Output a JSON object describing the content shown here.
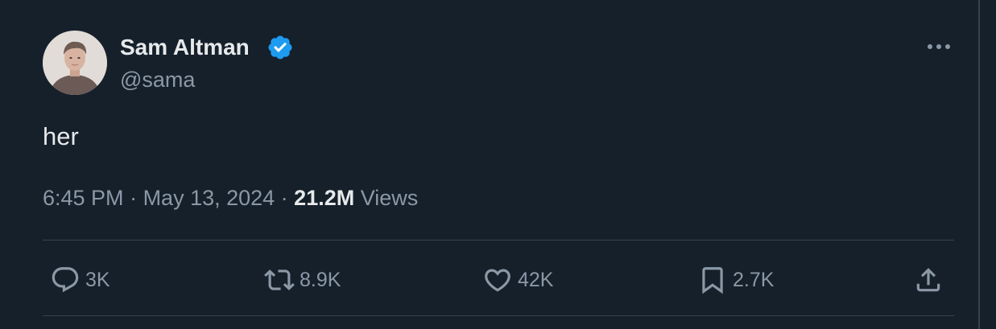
{
  "tweet": {
    "author": {
      "name": "Sam Altman",
      "handle": "@sama",
      "verified": true,
      "avatar_icon": "avatar-photo"
    },
    "text": "her",
    "meta": {
      "time": "6:45 PM",
      "separator": " · ",
      "date": "May 13, 2024",
      "views_count": "21.2M",
      "views_label": " Views"
    },
    "actions": {
      "reply": {
        "icon": "reply-icon",
        "count": "3K"
      },
      "retweet": {
        "icon": "retweet-icon",
        "count": "8.9K"
      },
      "like": {
        "icon": "heart-icon",
        "count": "42K"
      },
      "bookmark": {
        "icon": "bookmark-icon",
        "count": "2.7K"
      },
      "share": {
        "icon": "share-icon"
      }
    }
  },
  "colors": {
    "background": "#15202b",
    "text_primary": "#e7e9ea",
    "text_secondary": "#8b98a5",
    "border": "#38444d",
    "verified_blue": "#1d9bf0"
  }
}
